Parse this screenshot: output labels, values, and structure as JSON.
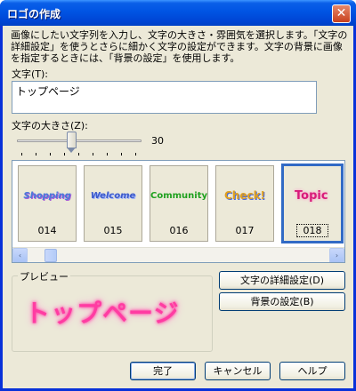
{
  "window": {
    "title": "ロゴの作成",
    "close_glyph": "✕"
  },
  "description": "画像にしたい文字列を入力し、文字の大きさ・雰囲気を選択します。「文字の詳細設定」を使うとさらに細かく文字の設定ができます。文字の背景に画像を指定するときには、「背景の設定」を使用します。",
  "text_field": {
    "label": "文字(T):",
    "value": "トップページ"
  },
  "size_slider": {
    "label": "文字の大きさ(Z):",
    "value": "30",
    "level_fraction": 0.45
  },
  "gallery": {
    "items": [
      {
        "number": "014",
        "art": "Shopping",
        "color": "#4a7bd8"
      },
      {
        "number": "015",
        "art": "Welcome",
        "color": "#3d5bc9"
      },
      {
        "number": "016",
        "art": "Community",
        "color": "#1ea01e"
      },
      {
        "number": "017",
        "art": "Check!",
        "color": "#e0a020"
      },
      {
        "number": "018",
        "art": "Topic",
        "color": "#d81b7a",
        "selected": true
      }
    ],
    "scroll_left_glyph": "‹",
    "scroll_right_glyph": "›"
  },
  "preview": {
    "label": "プレビュー",
    "text": "トップページ",
    "color": "#ff3ca2"
  },
  "buttons": {
    "font_detail": "文字の詳細設定(D)",
    "background": "背景の設定(B)",
    "ok": "完了",
    "cancel": "キャンセル",
    "help": "ヘルプ"
  },
  "colors": {
    "title_bar": "#0054e3",
    "selection": "#316ac5",
    "face": "#ece9d8"
  }
}
